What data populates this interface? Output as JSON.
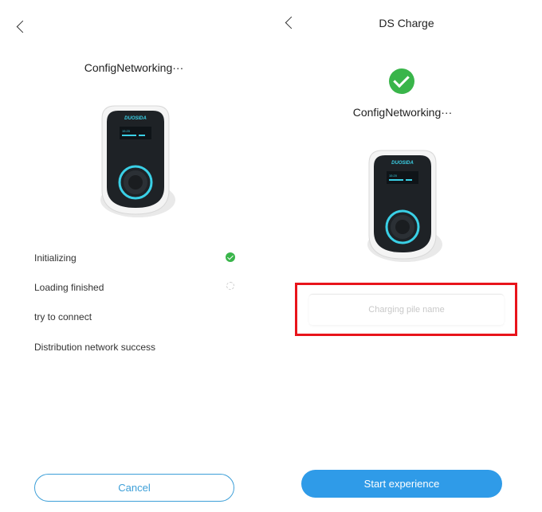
{
  "left_screen": {
    "title": "ConfigNetworking···",
    "steps": [
      {
        "label": "Initializing",
        "status": "done"
      },
      {
        "label": "Loading finished",
        "status": "pending"
      },
      {
        "label": "try to connect",
        "status": "none"
      },
      {
        "label": "Distribution network success",
        "status": "none"
      }
    ],
    "cancel_label": "Cancel"
  },
  "right_screen": {
    "app_title": "DS Charge",
    "subtitle": "ConfigNetworking···",
    "name_placeholder": "Charging pile name",
    "start_label": "Start experience"
  },
  "charger": {
    "brand": "DUOSIDA",
    "screen_time": "15:20"
  },
  "icons": {
    "back": "chevron-left-icon",
    "success": "check-circle-icon",
    "pending": "loading-circle-icon"
  },
  "colors": {
    "accent_blue": "#2f9be8",
    "success_green": "#39b54a",
    "highlight_red": "#e8141b",
    "charger_ring": "#3ad0e6"
  }
}
